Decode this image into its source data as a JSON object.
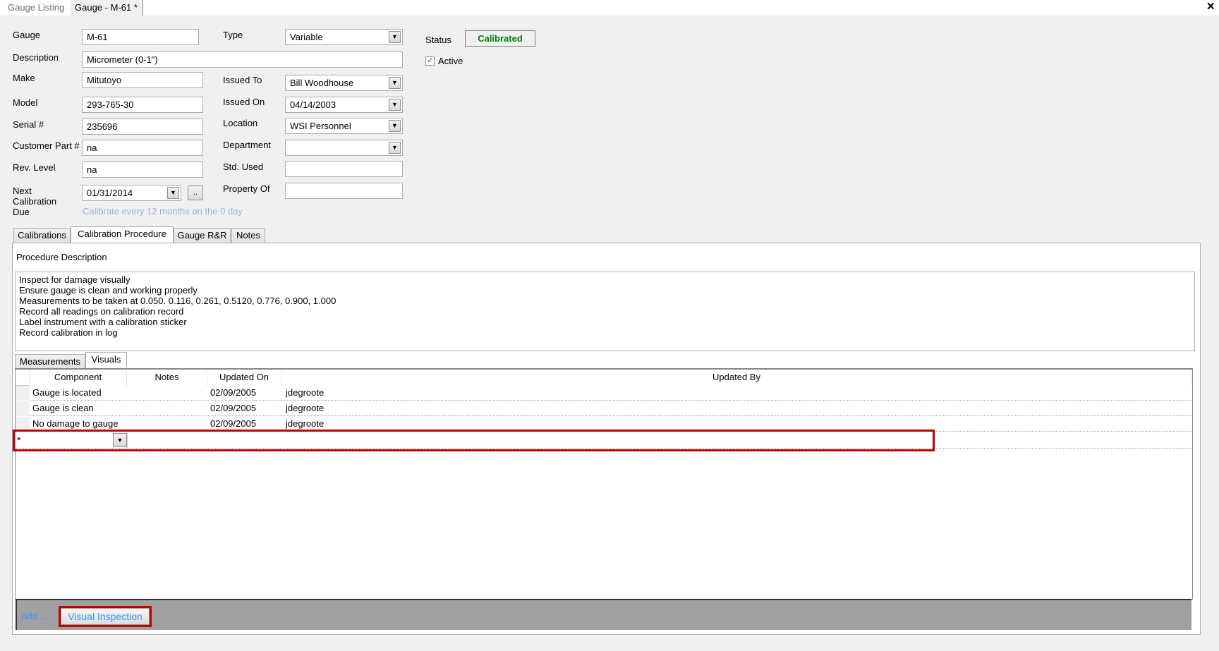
{
  "doc_tabs": [
    {
      "label": "Gauge Listing",
      "active": false
    },
    {
      "label": "Gauge - M-61 *",
      "active": true
    }
  ],
  "close_icon": "close-x",
  "form": {
    "gauge": {
      "label": "Gauge",
      "value": "M-61"
    },
    "description": {
      "label": "Description",
      "value": "Micrometer (0-1\")"
    },
    "make": {
      "label": "Make",
      "value": "Mitutoyo"
    },
    "model": {
      "label": "Model",
      "value": "293-765-30"
    },
    "serial": {
      "label": "Serial #",
      "value": "235696"
    },
    "customer_part": {
      "label": "Customer Part #",
      "value": "na"
    },
    "rev_level": {
      "label": "Rev. Level",
      "value": "na"
    },
    "next_cal": {
      "label": "Next Calibration Due",
      "value": "01/31/2014",
      "button": "..",
      "hint": "Calibrate every 12 months on the 0 day"
    },
    "type": {
      "label": "Type",
      "value": "Variable"
    },
    "issued_to": {
      "label": "Issued To",
      "value": "Bill Woodhouse"
    },
    "issued_on": {
      "label": "Issued On",
      "value": "04/14/2003"
    },
    "location": {
      "label": "Location",
      "value": "WSI Personnel"
    },
    "department": {
      "label": "Department",
      "value": ""
    },
    "std_used": {
      "label": "Std. Used",
      "value": ""
    },
    "property_of": {
      "label": "Property Of",
      "value": ""
    },
    "status": {
      "label": "Status",
      "value": "Calibrated",
      "color": "#008000"
    },
    "active": {
      "label": "Active",
      "checked": true
    }
  },
  "tabs": [
    "Calibrations",
    "Calibration Procedure",
    "Gauge R&R",
    "Notes"
  ],
  "active_tab": "Calibration Procedure",
  "procedure": {
    "label": "Procedure Description",
    "lines": [
      "Inspect for damage visually",
      "Ensure gauge is clean and working properly",
      "Measurements to be taken at 0.050. 0.116, 0.261, 0.5120, 0.776, 0.900, 1.000",
      "Record all readings on calibration record",
      "Label instrument with a calibration sticker",
      "Record calibration in log"
    ]
  },
  "subtabs": [
    "Measurements",
    "Visuals"
  ],
  "active_subtab": "Visuals",
  "grid": {
    "columns": [
      "Component",
      "Notes",
      "Updated On",
      "Updated By"
    ],
    "rows": [
      {
        "component": "Gauge is located",
        "notes": "",
        "updated_on": "02/09/2005",
        "updated_by": "jdegroote"
      },
      {
        "component": "Gauge is clean",
        "notes": "",
        "updated_on": "02/09/2005",
        "updated_by": "jdegroote"
      },
      {
        "component": "No damage to gauge",
        "notes": "",
        "updated_on": "02/09/2005",
        "updated_by": "jdegroote"
      }
    ],
    "new_row_marker": "*"
  },
  "footer": {
    "add_label": "Add ...",
    "visual_button": "Visual Inspection"
  },
  "colors": {
    "highlight": "#c00000",
    "link": "#3399ff",
    "hint": "#99b4d1"
  }
}
